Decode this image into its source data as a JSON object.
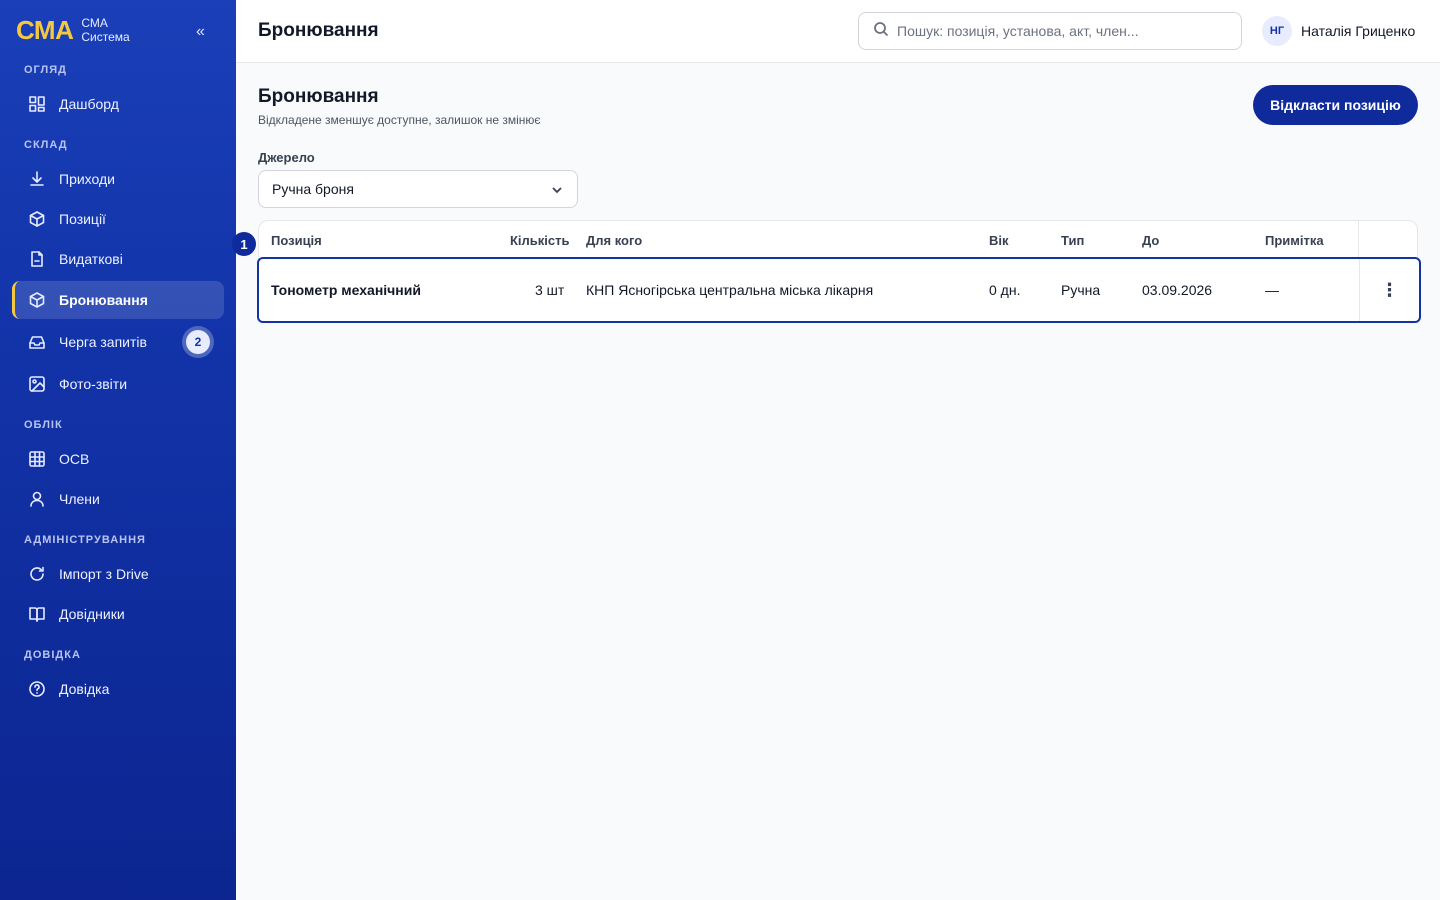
{
  "brand": {
    "logo": "СМА",
    "line1": "СМА",
    "line2": "Система",
    "collapse": "«"
  },
  "sidebar": {
    "sections": [
      {
        "title": "ОГЛЯД"
      },
      {
        "title": "СКЛАД"
      },
      {
        "title": "ОБЛІК"
      },
      {
        "title": "АДМІНІСТРУВАННЯ"
      },
      {
        "title": "ДОВІДКА"
      }
    ],
    "items": [
      {
        "label": "Дашборд",
        "icon": "dashboard-icon"
      },
      {
        "label": "Приходи",
        "icon": "download-icon"
      },
      {
        "label": "Позиції",
        "icon": "box-icon"
      },
      {
        "label": "Видаткові",
        "icon": "document-icon"
      },
      {
        "label": "Бронювання",
        "icon": "box-icon",
        "active": true
      },
      {
        "label": "Черга запитів",
        "icon": "inbox-icon",
        "badge": "2"
      },
      {
        "label": "Фото-звіти",
        "icon": "image-icon"
      },
      {
        "label": "ОСВ",
        "icon": "table-icon"
      },
      {
        "label": "Члени",
        "icon": "user-icon"
      },
      {
        "label": "Імпорт з Drive",
        "icon": "refresh-icon"
      },
      {
        "label": "Довідники",
        "icon": "book-icon"
      },
      {
        "label": "Довідка",
        "icon": "help-icon"
      }
    ]
  },
  "header": {
    "title": "Бронювання",
    "search_placeholder": "Пошук: позиція, установа, акт, член...",
    "user_initials": "НГ",
    "user_name": "Наталія Гриценко"
  },
  "main": {
    "title": "Бронювання",
    "subtitle": "Відкладене зменшує доступне, залишок не змінює",
    "primary_button": "Відкласти позицію",
    "source_label": "Джерело",
    "source_value": "Ручна броня",
    "row_marker": "1",
    "table": {
      "columns": [
        "Позиція",
        "Кількість",
        "Для кого",
        "Вік",
        "Тип",
        "До",
        "Примітка"
      ],
      "rows": [
        {
          "position": "Тонометр механічний",
          "quantity": "3 шт",
          "for_whom": "КНП Ясногірська центральна міська лікарня",
          "age": "0 дн.",
          "type": "Ручна",
          "until": "03.09.2026",
          "note": "—",
          "menu": "⋮"
        }
      ]
    }
  },
  "colors": {
    "sidebar": "#1233a8",
    "accent": "#f5c842",
    "primary": "#0f2a9a"
  }
}
